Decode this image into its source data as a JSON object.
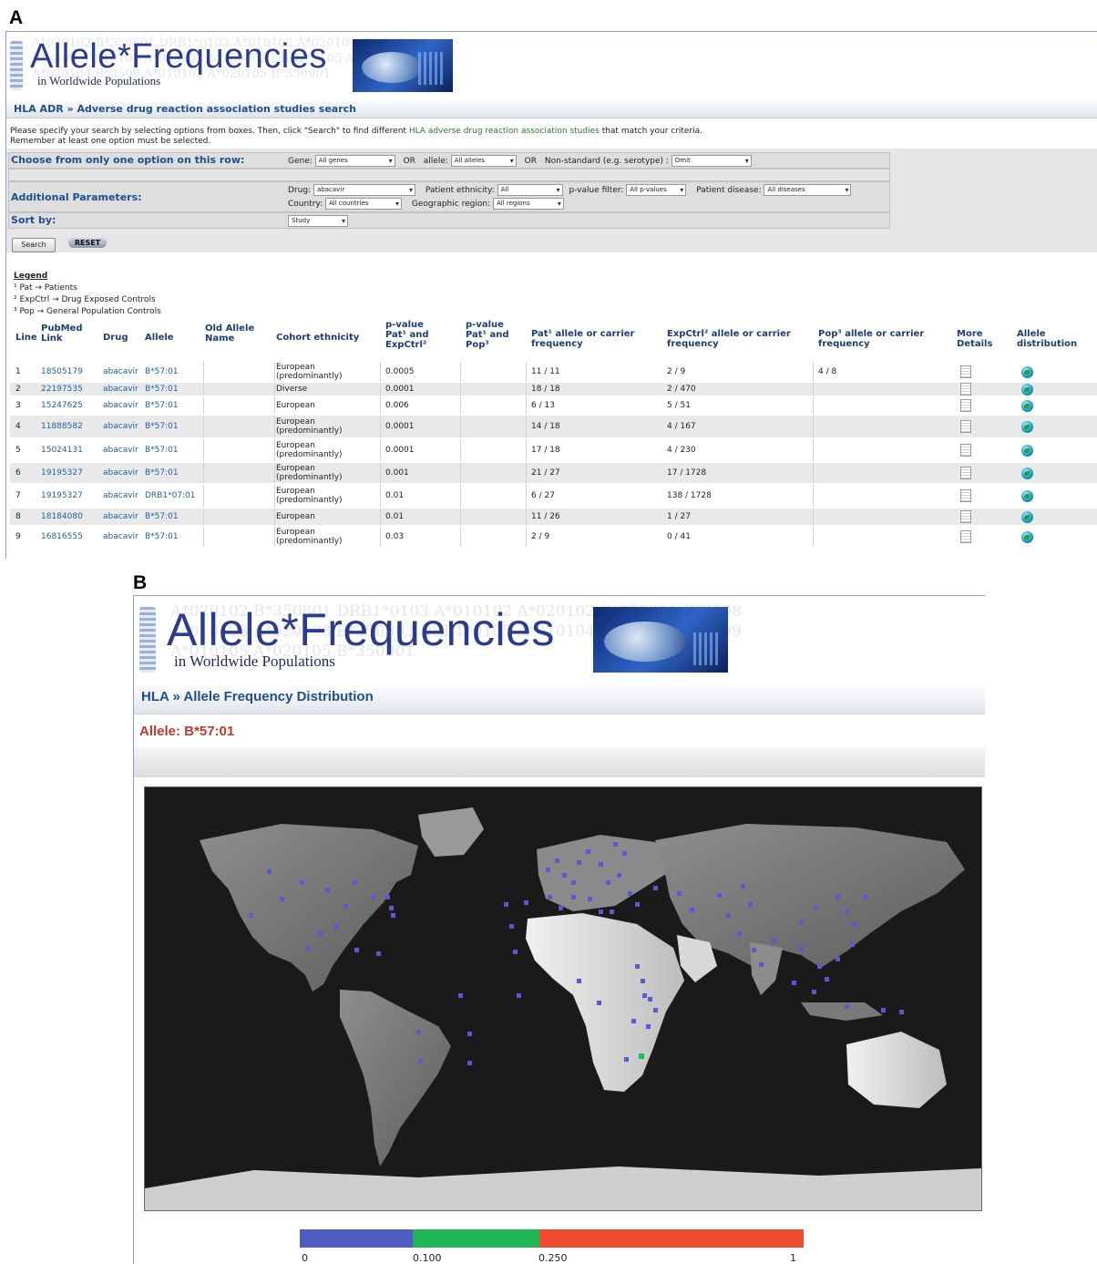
{
  "panel_a_letter": "A",
  "panel_b_letter": "B",
  "banner": {
    "title": "Allele*Frequencies",
    "subtitle": "in Worldwide Populations",
    "background_alleles": "A*020102 B*350801 DRB1*0103 A*010102 A*020102 B*350801 B*3508 A*010103 A*020103 B*350803 DRB1*0105 A*010104 A*020104 B*3509 A*010105 A*020105 B*350901"
  },
  "panelA": {
    "breadcrumb": "HLA ADR » Adverse drug reaction association studies search",
    "instructions": {
      "line1_pre": "Please specify your search by selecting options from boxes. Then, click \"Search\" to find different ",
      "line1_link": "HLA adverse drug reaction association studies",
      "line1_post": " that match your criteria.",
      "line2": "Remember at least one option must be selected."
    },
    "form": {
      "row1_label": "Choose from only one option on this row:",
      "gene_label": "Gene:",
      "gene_value": "All genes",
      "or1": "OR",
      "allele_label": "allele:",
      "allele_value": "All alleles",
      "or2": "OR",
      "nonstandard_label": "Non-standard (e.g. serotype) :",
      "nonstandard_value": "Omit",
      "row2_label": "Additional Parameters:",
      "drug_label": "Drug:",
      "drug_value": "abacavir",
      "ethnicity_label": "Patient ethnicity:",
      "ethnicity_value": "All",
      "pvalue_label": "p-value filter:",
      "pvalue_value": "All p-values",
      "disease_label": "Patient disease:",
      "disease_value": "All diseases",
      "country_label": "Country:",
      "country_value": "All countries",
      "region_label": "Geographic region:",
      "region_value": "All regions",
      "row3_label": "Sort by:",
      "sort_value": "Study",
      "search_button": "Search",
      "reset_button": "RESET"
    },
    "legend": {
      "title": "Legend",
      "items": [
        "¹ Pat → Patients",
        "² ExpCtrl → Drug Exposed Controls",
        "³ Pop → General Population Controls"
      ]
    },
    "table": {
      "headers": {
        "line": "Line",
        "pubmed": "PubMed Link",
        "drug": "Drug",
        "allele": "Allele",
        "old": "Old Allele Name",
        "cohort": "Cohort ethnicity",
        "pv1": "p-value Pat¹ and ExpCtrl²",
        "pv2": "p-value Pat¹ and Pop³",
        "patf": "Pat¹ allele or carrier frequency",
        "expf": "ExpCtrl² allele or carrier frequency",
        "popf": "Pop³ allele or carrier frequency",
        "more": "More Details",
        "dist": "Allele distribution"
      },
      "rows": [
        {
          "line": "1",
          "pubmed": "18505179",
          "drug": "abacavir",
          "allele": "B*57:01",
          "old": "",
          "cohort": "European (predominantly)",
          "pv1": "0.0005",
          "pv2": "",
          "patf": "11 / 11",
          "expf": "2 / 9",
          "popf": "4 / 8"
        },
        {
          "line": "2",
          "pubmed": "22197535",
          "drug": "abacavir",
          "allele": "B*57:01",
          "old": "",
          "cohort": "Diverse",
          "pv1": "0.0001",
          "pv2": "",
          "patf": "18 / 18",
          "expf": "2 / 470",
          "popf": ""
        },
        {
          "line": "3",
          "pubmed": "15247625",
          "drug": "abacavir",
          "allele": "B*57:01",
          "old": "",
          "cohort": "European",
          "pv1": "0.006",
          "pv2": "",
          "patf": "6 / 13",
          "expf": "5 / 51",
          "popf": ""
        },
        {
          "line": "4",
          "pubmed": "11888582",
          "drug": "abacavir",
          "allele": "B*57:01",
          "old": "",
          "cohort": "European (predominantly)",
          "pv1": "0.0001",
          "pv2": "",
          "patf": "14 / 18",
          "expf": "4 / 167",
          "popf": ""
        },
        {
          "line": "5",
          "pubmed": "15024131",
          "drug": "abacavir",
          "allele": "B*57:01",
          "old": "",
          "cohort": "European (predominantly)",
          "pv1": "0.0001",
          "pv2": "",
          "patf": "17 / 18",
          "expf": "4 / 230",
          "popf": ""
        },
        {
          "line": "6",
          "pubmed": "19195327",
          "drug": "abacavir",
          "allele": "B*57:01",
          "old": "",
          "cohort": "European (predominantly)",
          "pv1": "0.001",
          "pv2": "",
          "patf": "21 / 27",
          "expf": "17 / 1728",
          "popf": ""
        },
        {
          "line": "7",
          "pubmed": "19195327",
          "drug": "abacavir",
          "allele": "DRB1*07:01",
          "old": "",
          "cohort": "European (predominantly)",
          "pv1": "0.01",
          "pv2": "",
          "patf": "6 / 27",
          "expf": "138 / 1728",
          "popf": ""
        },
        {
          "line": "8",
          "pubmed": "18184080",
          "drug": "abacavir",
          "allele": "B*57:01",
          "old": "",
          "cohort": "European",
          "pv1": "0.01",
          "pv2": "",
          "patf": "11 / 26",
          "expf": "1 / 27",
          "popf": ""
        },
        {
          "line": "9",
          "pubmed": "16816555",
          "drug": "abacavir",
          "allele": "B*57:01",
          "old": "",
          "cohort": "European (predominantly)",
          "pv1": "0.03",
          "pv2": "",
          "patf": "2 / 9",
          "expf": "0 / 41",
          "popf": ""
        }
      ]
    }
  },
  "panelB": {
    "breadcrumb": "HLA » Allele Frequency Distribution",
    "allele_title": "Allele: B*57:01",
    "map_marker_color_low": "#5a5ad0",
    "map_marker_color_mid": "#22c05a",
    "colorbar": {
      "segments": [
        {
          "from": 0,
          "to": 0.1,
          "color": "#4f5cc4"
        },
        {
          "from": 0.1,
          "to": 0.25,
          "color": "#1fb556"
        },
        {
          "from": 0.25,
          "to": 1,
          "color": "#ee4a32"
        }
      ],
      "labels": [
        "0",
        "0.100",
        "0.250",
        "1"
      ]
    }
  }
}
